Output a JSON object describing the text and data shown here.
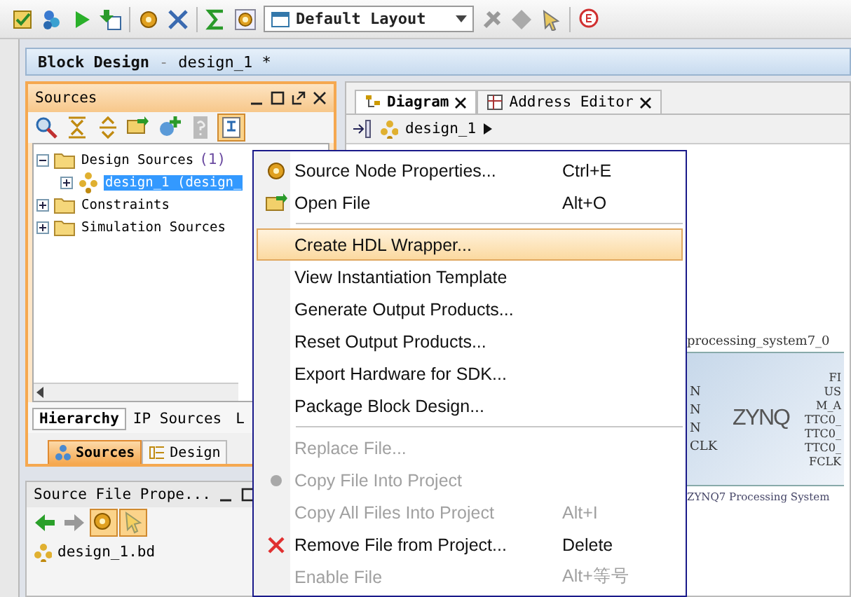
{
  "toolbar": {
    "layout_dropdown": "Default Layout"
  },
  "header": {
    "title": "Block Design",
    "separator": "-",
    "design": "design_1 *"
  },
  "sources_panel": {
    "title": "Sources",
    "tree": [
      {
        "label": "Design Sources",
        "count": "(1)",
        "expanded": true,
        "selected": false,
        "children": [
          {
            "label": "design_1 (design_",
            "expanded": false,
            "selected": false,
            "highlighted": true
          }
        ]
      },
      {
        "label": "Constraints",
        "expanded": false,
        "selected": false
      },
      {
        "label": "Simulation Sources",
        "expanded": false,
        "selected": false
      }
    ],
    "view_tabs": [
      {
        "label": "Hierarchy",
        "selected": true
      },
      {
        "label": "IP Sources",
        "selected": false
      },
      {
        "label": "L",
        "selected": false
      }
    ],
    "panel_tabs": [
      {
        "label": "Sources",
        "selected": true
      },
      {
        "label": "Design",
        "selected": false
      }
    ]
  },
  "properties_panel": {
    "title": "Source File Prope...",
    "file": "design_1.bd"
  },
  "diagram": {
    "tabs": [
      {
        "label": "Diagram",
        "selected": true
      },
      {
        "label": "Address Editor",
        "selected": false
      }
    ],
    "breadcrumb": "design_1",
    "block": {
      "name": "processing_system7_0",
      "logo": "ZYNQ",
      "left_pins": [
        "N",
        "N",
        "N",
        "CLK"
      ],
      "right_pins": [
        "FI",
        "US",
        "M_A",
        "TTC0_",
        "TTC0_",
        "TTC0_",
        "FCLK"
      ],
      "caption": "ZYNQ7 Processing System"
    }
  },
  "context_menu": [
    {
      "kind": "item",
      "label": "Source Node Properties...",
      "shortcut": "Ctrl+E",
      "disabled": false,
      "selected": false
    },
    {
      "kind": "item",
      "label": "Open File",
      "shortcut": "Alt+O",
      "disabled": false,
      "selected": false
    },
    {
      "kind": "separator"
    },
    {
      "kind": "item",
      "label": "Create HDL Wrapper...",
      "disabled": false,
      "selected": true
    },
    {
      "kind": "item",
      "label": "View Instantiation Template",
      "disabled": false,
      "selected": false
    },
    {
      "kind": "item",
      "label": "Generate Output Products...",
      "disabled": false,
      "selected": false
    },
    {
      "kind": "item",
      "label": "Reset Output Products...",
      "disabled": false,
      "selected": false
    },
    {
      "kind": "item",
      "label": "Export Hardware for SDK...",
      "disabled": false,
      "selected": false
    },
    {
      "kind": "item",
      "label": "Package Block Design...",
      "disabled": false,
      "selected": false
    },
    {
      "kind": "separator"
    },
    {
      "kind": "item",
      "label": "Replace File...",
      "disabled": true,
      "selected": false
    },
    {
      "kind": "item",
      "label": "Copy File Into Project",
      "disabled": true,
      "selected": false
    },
    {
      "kind": "item",
      "label": "Copy All Files Into Project",
      "shortcut": "Alt+I",
      "disabled": true,
      "selected": false
    },
    {
      "kind": "item",
      "label": "Remove File from Project...",
      "shortcut": "Delete",
      "disabled": false,
      "selected": false
    },
    {
      "kind": "item",
      "label": "Enable File",
      "shortcut": "Alt+等号",
      "disabled": true,
      "selected": false
    }
  ]
}
